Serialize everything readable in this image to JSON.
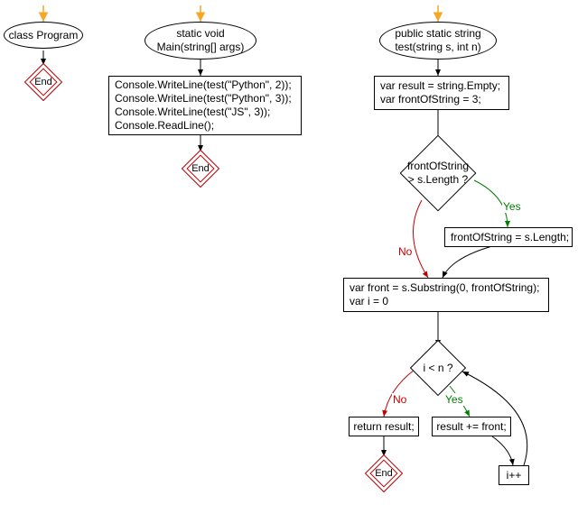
{
  "chart_data": {
    "type": "flowchart",
    "subgraphs": [
      {
        "nodes": [
          {
            "id": "A_start",
            "type": "start-arrow"
          },
          {
            "id": "A_class",
            "type": "ellipse",
            "label": "class Program"
          },
          {
            "id": "A_end",
            "type": "end",
            "label": "End"
          }
        ],
        "edges": [
          {
            "from": "A_start",
            "to": "A_class",
            "color": "#f5a623"
          },
          {
            "from": "A_class",
            "to": "A_end"
          }
        ]
      },
      {
        "nodes": [
          {
            "id": "B_start",
            "type": "start-arrow"
          },
          {
            "id": "B_main",
            "type": "ellipse",
            "label": "static void\nMain(string[] args)"
          },
          {
            "id": "B_body",
            "type": "rect",
            "label": "Console.WriteLine(test(\"Python\", 2));\nConsole.WriteLine(test(\"Python\", 3));\nConsole.WriteLine(test(\"JS\", 3));\nConsole.ReadLine();"
          },
          {
            "id": "B_end",
            "type": "end",
            "label": "End"
          }
        ],
        "edges": [
          {
            "from": "B_start",
            "to": "B_main",
            "color": "#f5a623"
          },
          {
            "from": "B_main",
            "to": "B_body"
          },
          {
            "from": "B_body",
            "to": "B_end"
          }
        ]
      },
      {
        "nodes": [
          {
            "id": "C_start",
            "type": "start-arrow"
          },
          {
            "id": "C_test",
            "type": "ellipse",
            "label": "public static string\ntest(string s, int n)"
          },
          {
            "id": "C_init",
            "type": "rect",
            "label": "var result = string.Empty;\nvar frontOfString = 3;"
          },
          {
            "id": "C_cond1",
            "type": "decision",
            "label": "frontOfString\n> s.Length ?"
          },
          {
            "id": "C_assign",
            "type": "rect",
            "label": "frontOfString = s.Length;"
          },
          {
            "id": "C_front",
            "type": "rect",
            "label": "var front = s.Substring(0, frontOfString);\nvar i = 0"
          },
          {
            "id": "C_cond2",
            "type": "decision",
            "label": "i < n ?"
          },
          {
            "id": "C_return",
            "type": "rect",
            "label": "return result;"
          },
          {
            "id": "C_append",
            "type": "rect",
            "label": "result += front;"
          },
          {
            "id": "C_inc",
            "type": "rect",
            "label": "i++"
          },
          {
            "id": "C_end",
            "type": "end",
            "label": "End"
          }
        ],
        "edges": [
          {
            "from": "C_start",
            "to": "C_test",
            "color": "#f5a623"
          },
          {
            "from": "C_test",
            "to": "C_init"
          },
          {
            "from": "C_init",
            "to": "C_cond1"
          },
          {
            "from": "C_cond1",
            "to": "C_assign",
            "label": "Yes",
            "color": "#008000"
          },
          {
            "from": "C_cond1",
            "to": "C_front",
            "label": "No",
            "color": "#c00000"
          },
          {
            "from": "C_assign",
            "to": "C_front"
          },
          {
            "from": "C_front",
            "to": "C_cond2"
          },
          {
            "from": "C_cond2",
            "to": "C_append",
            "label": "Yes",
            "color": "#008000"
          },
          {
            "from": "C_cond2",
            "to": "C_return",
            "label": "No",
            "color": "#c00000"
          },
          {
            "from": "C_append",
            "to": "C_inc"
          },
          {
            "from": "C_inc",
            "to": "C_cond2"
          },
          {
            "from": "C_return",
            "to": "C_end"
          }
        ]
      }
    ]
  },
  "labels": {
    "yes": "Yes",
    "no": "No",
    "end": "End"
  },
  "nodes": {
    "A_class": "class Program",
    "B_main": "static void\nMain(string[] args)",
    "B_body": "Console.WriteLine(test(\"Python\", 2));\nConsole.WriteLine(test(\"Python\", 3));\nConsole.WriteLine(test(\"JS\", 3));\nConsole.ReadLine();",
    "C_test": "public static string\ntest(string s, int n)",
    "C_init": "var result = string.Empty;\nvar frontOfString = 3;",
    "C_cond1": "frontOfString\n> s.Length ?",
    "C_assign": "frontOfString = s.Length;",
    "C_front": "var front = s.Substring(0, frontOfString);\nvar i = 0",
    "C_cond2": "i < n ?",
    "C_return": "return result;",
    "C_append": "result += front;",
    "C_inc": "i++"
  }
}
